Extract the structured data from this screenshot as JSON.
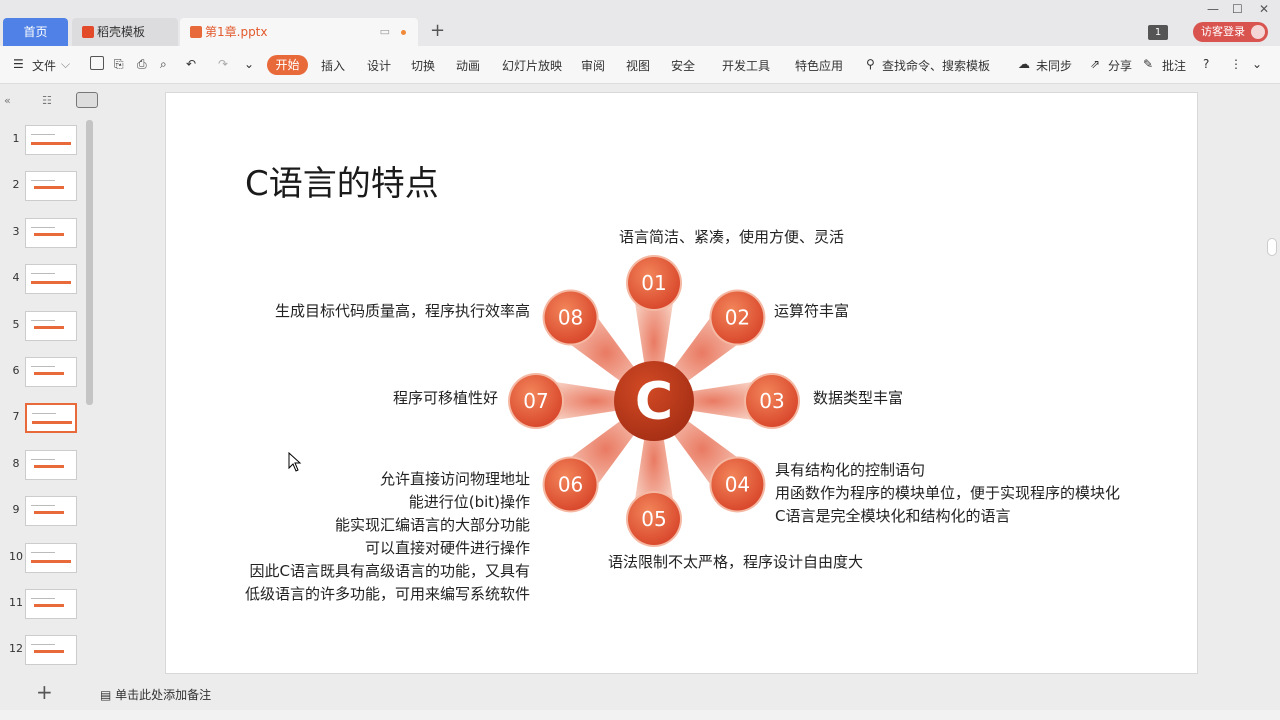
{
  "tabs": {
    "home": "首页",
    "daoke": "稻壳模板",
    "doc": "第1章.pptx"
  },
  "window": {
    "badge": "1",
    "login": "访客登录"
  },
  "menu": {
    "file": "文件",
    "start": "开始",
    "items": [
      "插入",
      "设计",
      "切换",
      "动画",
      "幻灯片放映",
      "审阅",
      "视图",
      "安全",
      "开发工具",
      "特色应用"
    ],
    "search": "查找命令、搜索模板",
    "sync": "未同步",
    "share": "分享",
    "comment": "批注"
  },
  "thumbnails": [
    "1",
    "2",
    "3",
    "4",
    "5",
    "6",
    "7",
    "8",
    "9",
    "10",
    "11",
    "12"
  ],
  "selected_slide": "7",
  "slide": {
    "title": "C语言的特点",
    "center_letter": "C",
    "nodes": [
      "01",
      "02",
      "03",
      "04",
      "05",
      "06",
      "07",
      "08"
    ],
    "feature_01": "语言简洁、紧凑，使用方便、灵活",
    "feature_02": "运算符丰富",
    "feature_03": "数据类型丰富",
    "feature_04": [
      "具有结构化的控制语句",
      "用函数作为程序的模块单位，便于实现程序的模块化",
      "C语言是完全模块化和结构化的语言"
    ],
    "feature_05": "语法限制不太严格，程序设计自由度大",
    "feature_06": [
      "允许直接访问物理地址",
      "能进行位(bit)操作",
      "能实现汇编语言的大部分功能",
      "可以直接对硬件进行操作",
      "因此C语言既具有高级语言的功能，又具有",
      "低级语言的许多功能，可用来编写系统软件"
    ],
    "feature_07": "程序可移植性好",
    "feature_08": "生成目标代码质量高，程序执行效率高"
  },
  "notes_placeholder": "单击此处添加备注",
  "colors": {
    "accent": "#e86a3a",
    "tab_blue": "#4f81e6",
    "center": "#b83a1c"
  }
}
